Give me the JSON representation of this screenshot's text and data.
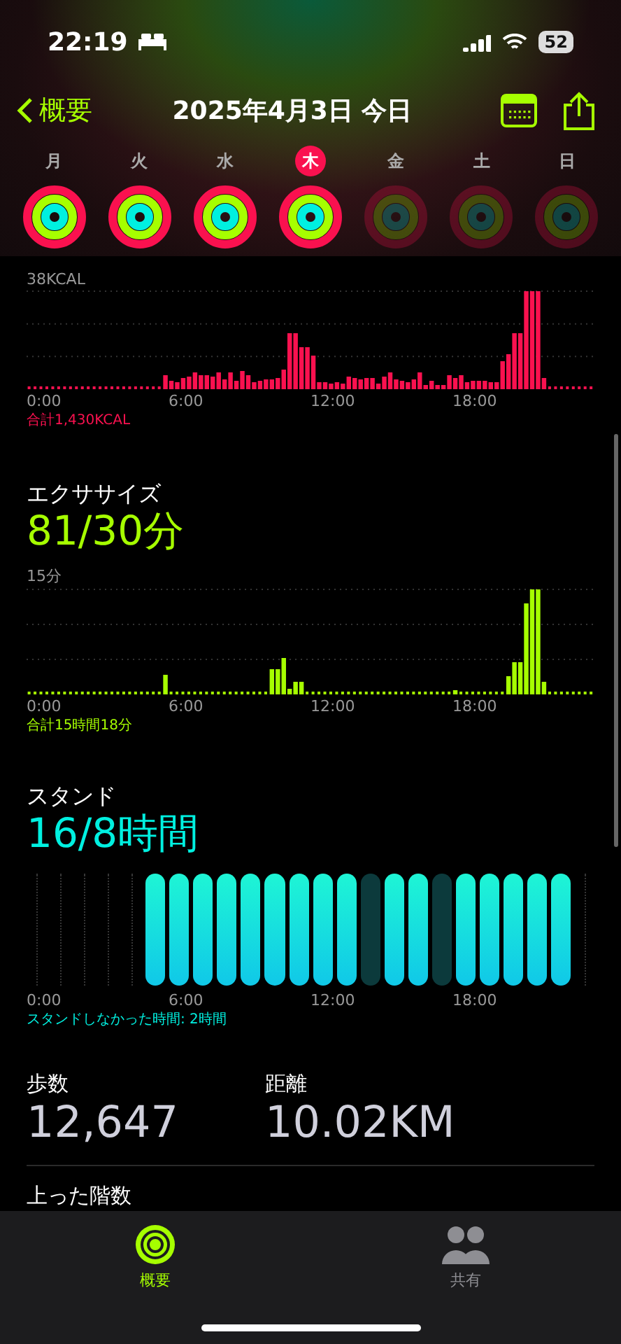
{
  "status_bar": {
    "time": "22:19",
    "battery": "52"
  },
  "nav": {
    "back": "概要",
    "title": "2025年4月3日 今日"
  },
  "days": [
    {
      "label": "月",
      "selected": false,
      "closed": true
    },
    {
      "label": "火",
      "selected": false,
      "closed": true
    },
    {
      "label": "水",
      "selected": false,
      "closed": true
    },
    {
      "label": "木",
      "selected": true,
      "closed": true
    },
    {
      "label": "金",
      "selected": false,
      "closed": false
    },
    {
      "label": "土",
      "selected": false,
      "closed": false
    },
    {
      "label": "日",
      "selected": false,
      "closed": false
    }
  ],
  "move": {
    "top_label": "38KCAL",
    "x_labels": [
      "0:00",
      "6:00",
      "12:00",
      "18:00"
    ],
    "total": "合計1,430KCAL"
  },
  "exercise": {
    "title": "エクササイズ",
    "value": "81/30分",
    "top_label": "15分",
    "x_labels": [
      "0:00",
      "6:00",
      "12:00",
      "18:00"
    ],
    "total": "合計15時間18分"
  },
  "stand": {
    "title": "スタンド",
    "value": "16/8時間",
    "x_labels": [
      "0:00",
      "6:00",
      "12:00",
      "18:00"
    ],
    "note": "スタンドしなかった時間: 2時間",
    "hours": [
      {
        "tracked": false,
        "stood": false
      },
      {
        "tracked": false,
        "stood": false
      },
      {
        "tracked": false,
        "stood": false
      },
      {
        "tracked": false,
        "stood": false
      },
      {
        "tracked": false,
        "stood": false
      },
      {
        "tracked": true,
        "stood": true
      },
      {
        "tracked": true,
        "stood": true
      },
      {
        "tracked": true,
        "stood": true
      },
      {
        "tracked": true,
        "stood": true
      },
      {
        "tracked": true,
        "stood": true
      },
      {
        "tracked": true,
        "stood": true
      },
      {
        "tracked": true,
        "stood": true
      },
      {
        "tracked": true,
        "stood": true
      },
      {
        "tracked": true,
        "stood": true
      },
      {
        "tracked": true,
        "stood": false
      },
      {
        "tracked": true,
        "stood": true
      },
      {
        "tracked": true,
        "stood": true
      },
      {
        "tracked": true,
        "stood": false
      },
      {
        "tracked": true,
        "stood": true
      },
      {
        "tracked": true,
        "stood": true
      },
      {
        "tracked": true,
        "stood": true
      },
      {
        "tracked": true,
        "stood": true
      },
      {
        "tracked": true,
        "stood": true
      },
      {
        "tracked": false,
        "stood": false
      }
    ]
  },
  "stats": [
    {
      "label": "歩数",
      "value": "12,647"
    },
    {
      "label": "距離",
      "value": "10.02KM"
    }
  ],
  "next_section": "上った階数",
  "tabs": [
    {
      "label": "概要",
      "selected": true,
      "kind": "rings"
    },
    {
      "label": "共有",
      "selected": false,
      "kind": "people"
    }
  ]
}
